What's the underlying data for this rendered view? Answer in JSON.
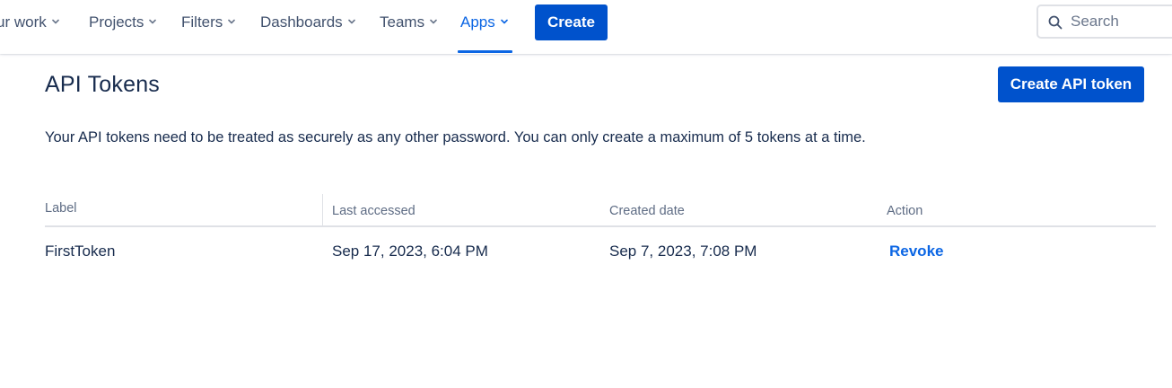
{
  "nav": {
    "items": [
      {
        "label": "ur work",
        "active": false
      },
      {
        "label": "Projects",
        "active": false
      },
      {
        "label": "Filters",
        "active": false
      },
      {
        "label": "Dashboards",
        "active": false
      },
      {
        "label": "Teams",
        "active": false
      },
      {
        "label": "Apps",
        "active": true
      }
    ],
    "create_label": "Create",
    "search": {
      "placeholder": "Search",
      "value": ""
    }
  },
  "page": {
    "title": "API Tokens",
    "create_token_label": "Create API token",
    "description": "Your API tokens need to be treated as securely as any other password. You can only create a maximum of 5 tokens at a time."
  },
  "table": {
    "columns": [
      "Label",
      "Last accessed",
      "Created date",
      "Action"
    ],
    "rows": [
      {
        "label": "FirstToken",
        "last_accessed": "Sep 17, 2023, 6:04 PM",
        "created_date": "Sep 7, 2023, 7:08 PM",
        "action": "Revoke"
      }
    ]
  },
  "colors": {
    "primary": "#0052cc",
    "link": "#0c66e4",
    "text": "#172b4d",
    "subtle_text": "#5e6c84",
    "border": "#dfe1e6"
  },
  "icons": [
    "chevron-down-icon",
    "search-icon"
  ]
}
